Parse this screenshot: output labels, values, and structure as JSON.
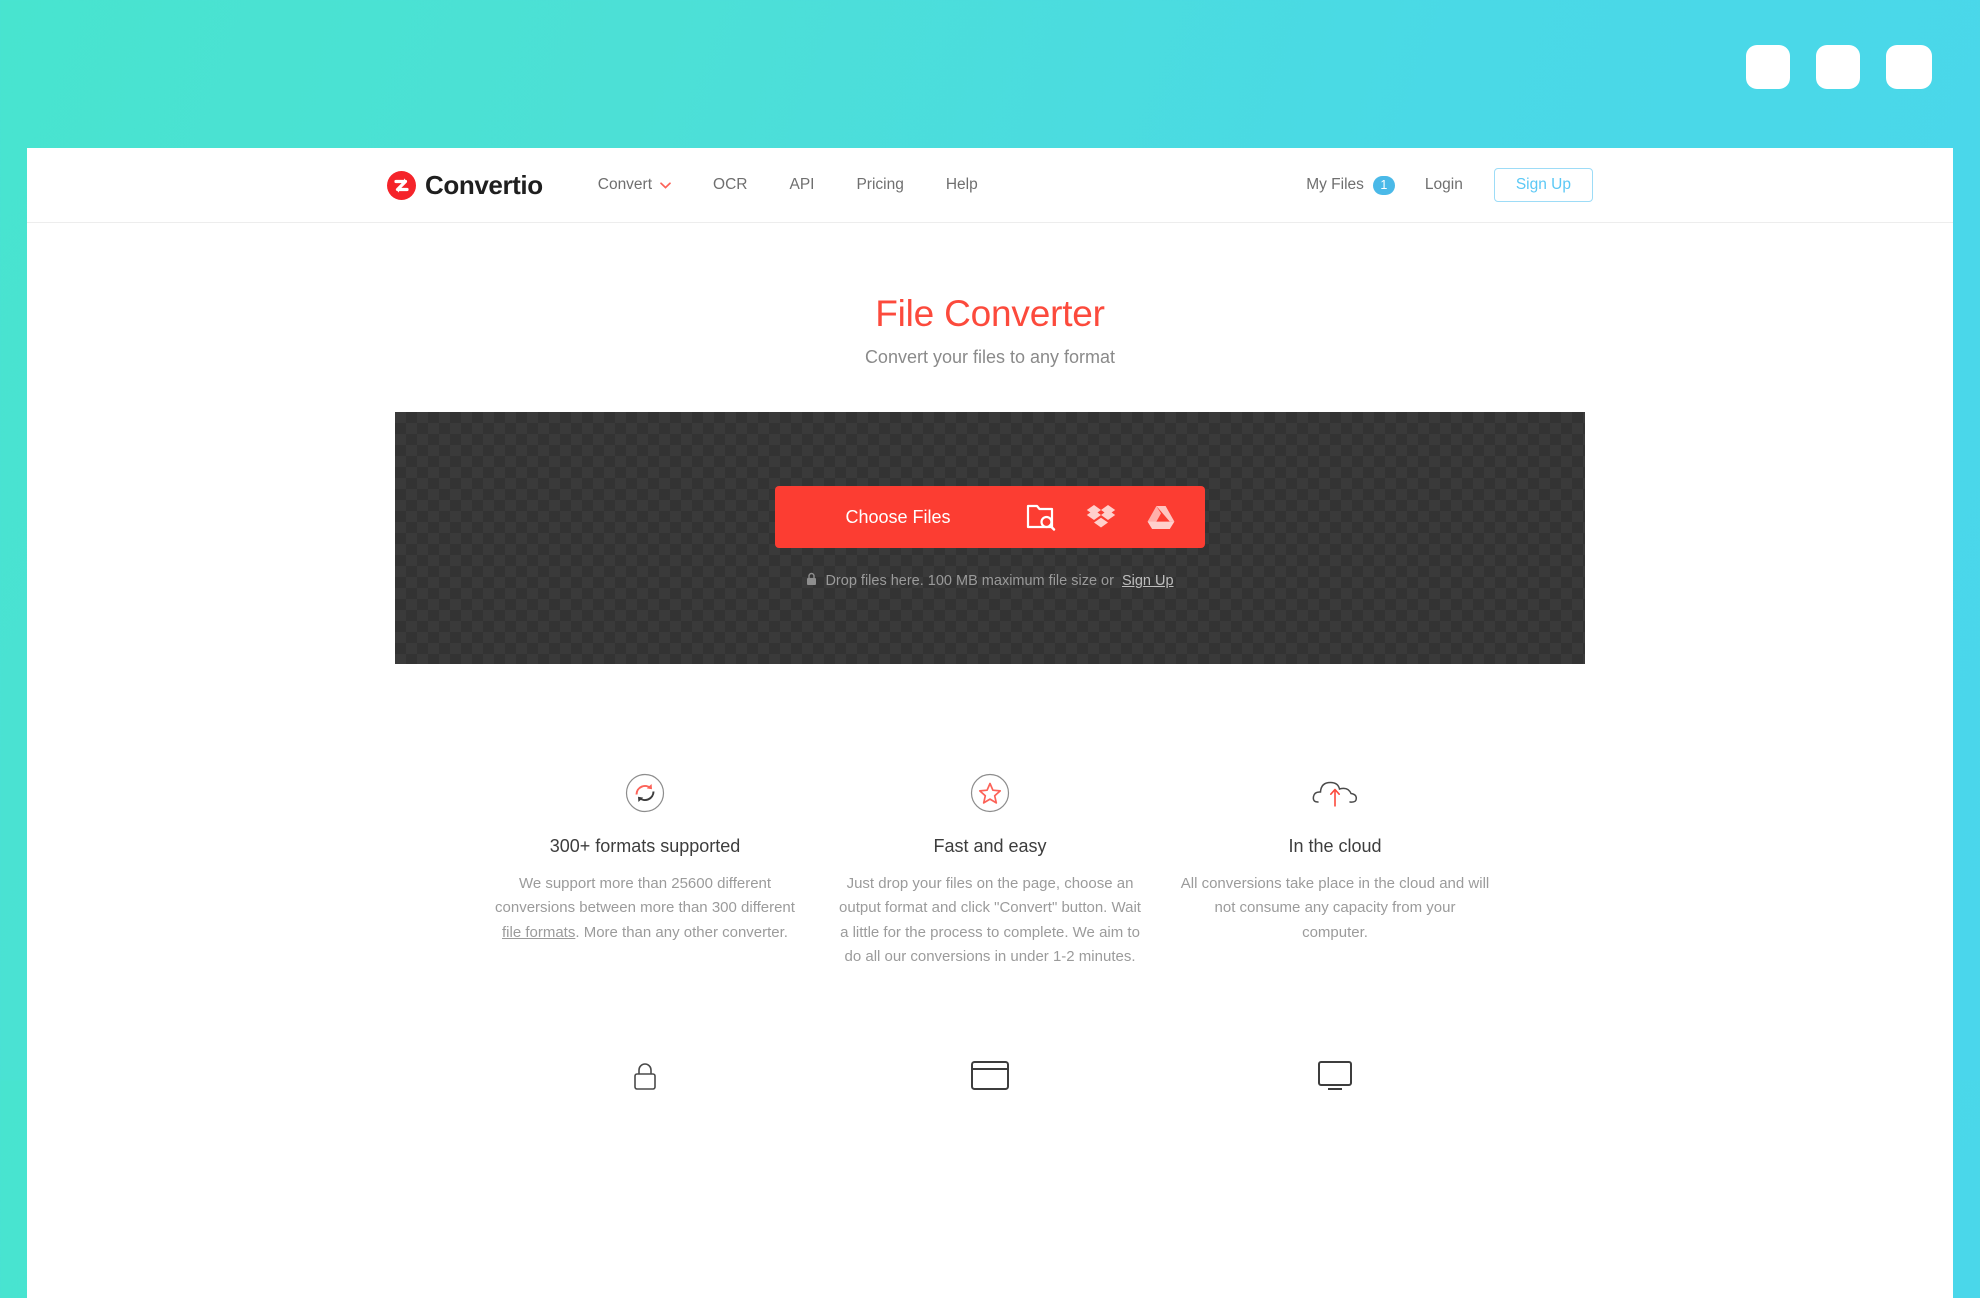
{
  "theme": {
    "accent_red": "#fc4a3c",
    "button_red": "#fc3d32",
    "accent_blue": "#5bc8f5",
    "badge_blue": "#4ab9e8",
    "bg_gradient_start": "#48e4cf",
    "bg_gradient_end": "#4ad6ec",
    "dropzone_dark": "#3a3a3a"
  },
  "window_controls": [
    {
      "name": "window-button-1"
    },
    {
      "name": "window-button-2"
    },
    {
      "name": "window-button-3"
    }
  ],
  "header": {
    "logo_text": "Convertio",
    "logo_icon": "convertio-logo-icon",
    "nav": [
      {
        "label": "Convert",
        "icon": "chevron-down-icon",
        "has_caret": true
      },
      {
        "label": "OCR",
        "has_caret": false
      },
      {
        "label": "API",
        "has_caret": false
      },
      {
        "label": "Pricing",
        "has_caret": false
      },
      {
        "label": "Help",
        "has_caret": false
      }
    ],
    "my_files_label": "My Files",
    "my_files_count": "1",
    "login_label": "Login",
    "signup_label": "Sign Up"
  },
  "hero": {
    "title": "File Converter",
    "subtitle": "Convert your files to any format"
  },
  "dropzone": {
    "choose_files_label": "Choose Files",
    "sources": [
      {
        "name": "from-computer-icon",
        "label": "From Computer"
      },
      {
        "name": "dropbox-icon",
        "label": "Dropbox"
      },
      {
        "name": "google-drive-icon",
        "label": "Google Drive"
      }
    ],
    "hint_lock_icon": "lock-icon",
    "hint_text": "Drop files here. 100 MB maximum file size or",
    "hint_link": "Sign Up"
  },
  "features": [
    {
      "icon": "formats-refresh-icon",
      "title": "300+ formats supported",
      "text_before": "We support more than 25600 different conversions between more than 300 different ",
      "link": "file formats",
      "text_after": ". More than any other converter."
    },
    {
      "icon": "star-icon",
      "title": "Fast and easy",
      "text_before": "Just drop your files on the page, choose an output format and click \"Convert\" button. Wait a little for the process to complete. We aim to do all our conversions in under 1-2 minutes.",
      "link": "",
      "text_after": ""
    },
    {
      "icon": "cloud-upload-icon",
      "title": "In the cloud",
      "text_before": "All conversions take place in the cloud and will not consume any capacity from your computer.",
      "link": "",
      "text_after": ""
    }
  ],
  "lower_row": [
    {
      "icon": "lock-icon"
    },
    {
      "icon": "browser-window-icon"
    },
    {
      "icon": "device-icon"
    }
  ]
}
